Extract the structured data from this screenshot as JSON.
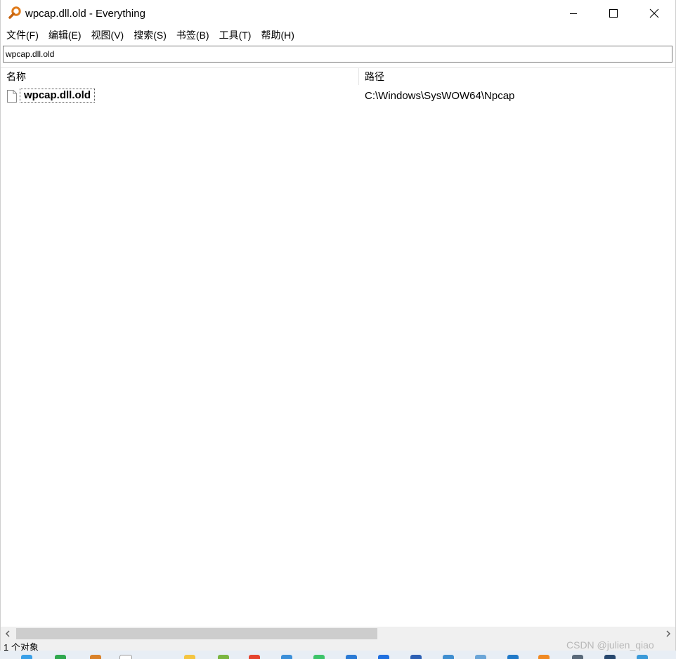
{
  "window": {
    "title": "wpcap.dll.old - Everything",
    "app_icon": "magnifier-icon",
    "controls": {
      "minimize_icon": "minimize-icon",
      "maximize_icon": "maximize-icon",
      "close_icon": "close-icon"
    }
  },
  "menu": {
    "items": [
      {
        "label": "文件(F)"
      },
      {
        "label": "编辑(E)"
      },
      {
        "label": "视图(V)"
      },
      {
        "label": "搜索(S)"
      },
      {
        "label": "书签(B)"
      },
      {
        "label": "工具(T)"
      },
      {
        "label": "帮助(H)"
      }
    ]
  },
  "search": {
    "value": "wpcap.dll.old"
  },
  "table": {
    "columns": [
      "名称",
      "路径"
    ],
    "rows": [
      {
        "name": "wpcap.dll.old",
        "path": "C:\\Windows\\SysWOW64\\Npcap",
        "icon": "file-icon"
      }
    ]
  },
  "status": {
    "text": "1 个对象"
  },
  "watermark": "CSDN @julien_qiao",
  "colors": {
    "accent_icon": "#e07b1a",
    "scroll_thumb": "#cdcdcd"
  }
}
